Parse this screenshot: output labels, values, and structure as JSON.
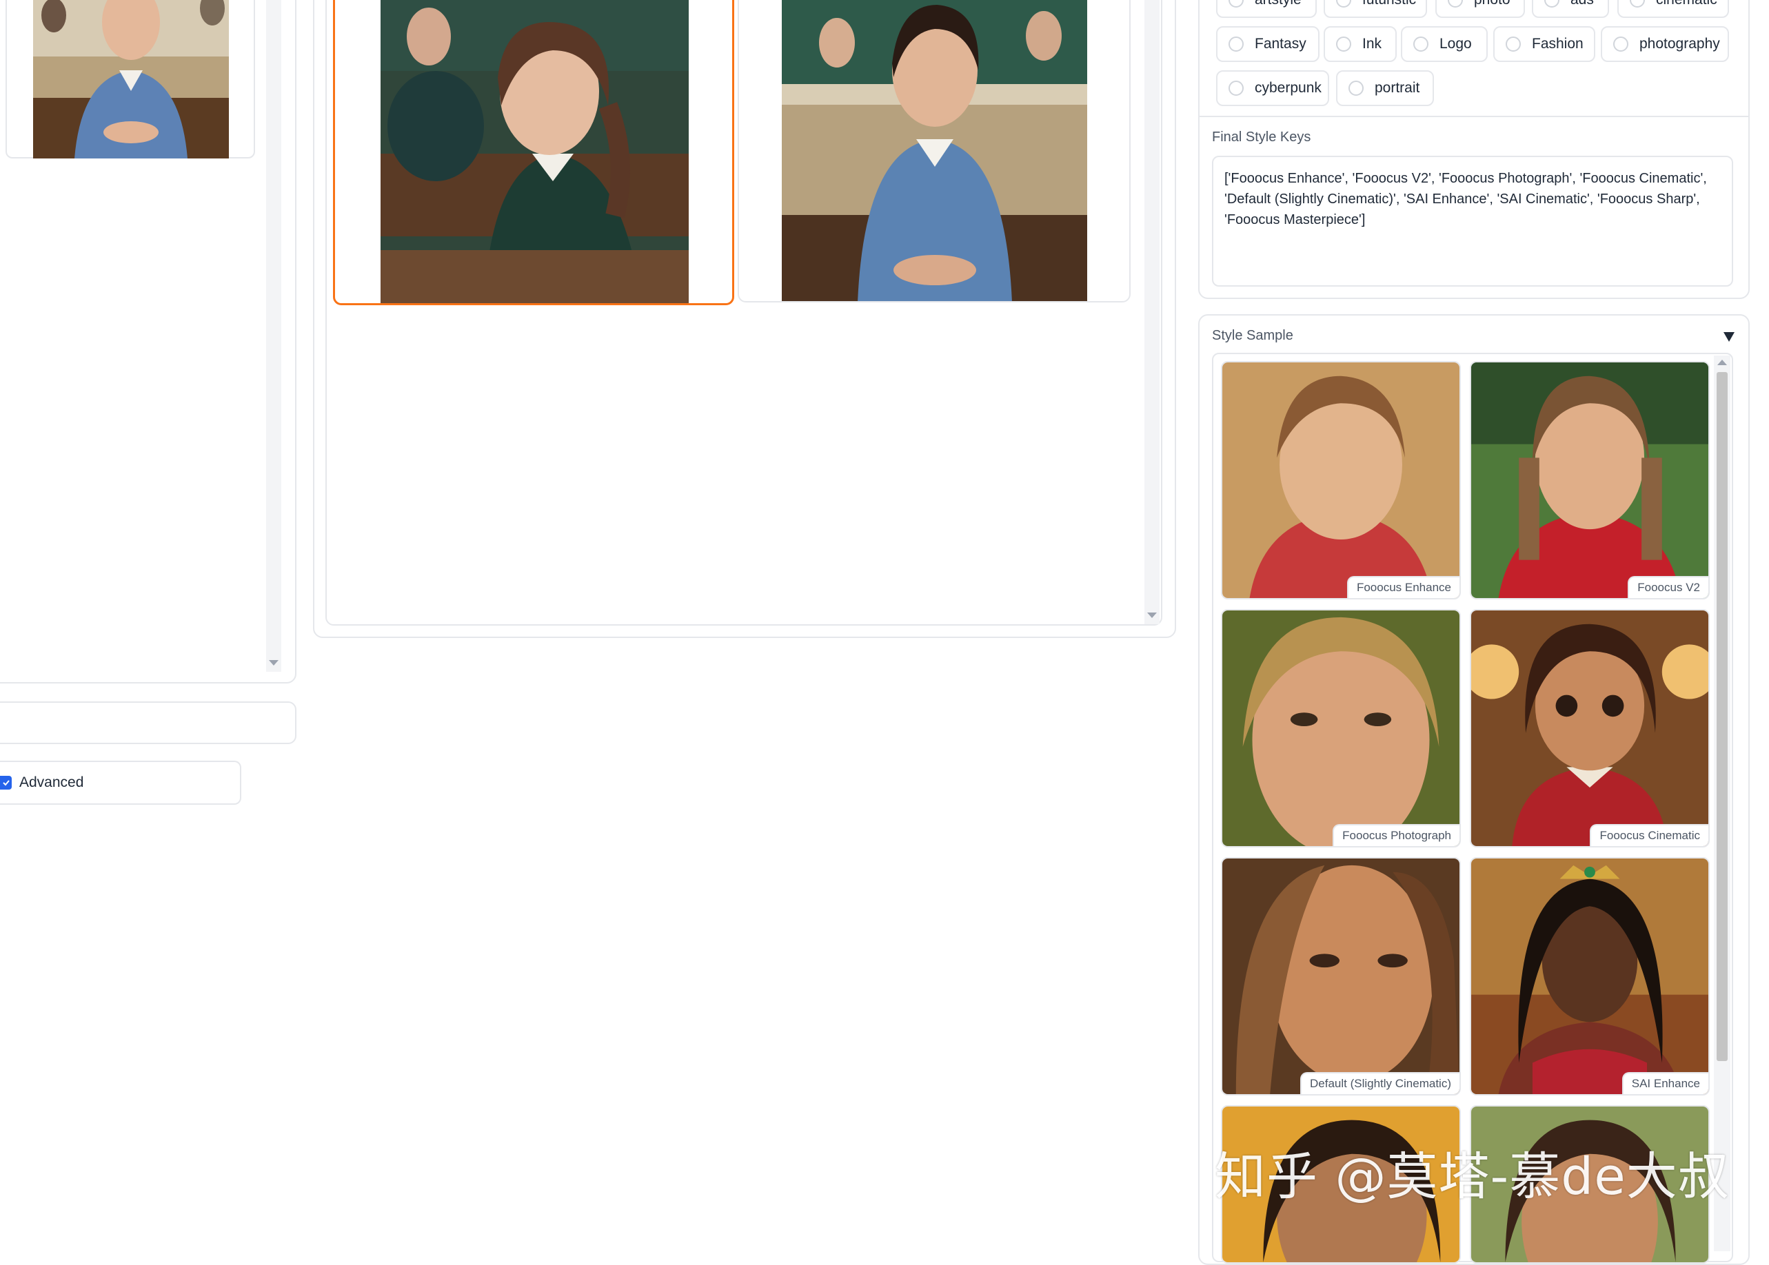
{
  "left_column": {
    "advanced_checkbox": {
      "label": "Advanced",
      "checked": true
    }
  },
  "style_filter_chips": [
    {
      "label": "artstyle"
    },
    {
      "label": "futuristic"
    },
    {
      "label": "photo"
    },
    {
      "label": "ads"
    },
    {
      "label": "cinematic"
    },
    {
      "label": "Fantasy"
    },
    {
      "label": "Ink"
    },
    {
      "label": "Logo"
    },
    {
      "label": "Fashion"
    },
    {
      "label": "photography"
    },
    {
      "label": "cyberpunk"
    },
    {
      "label": "portrait"
    }
  ],
  "final_style_keys": {
    "label": "Final Style Keys",
    "value": "['Fooocus Enhance', 'Fooocus V2', 'Fooocus Photograph', 'Fooocus Cinematic', 'Default (Slightly Cinematic)', 'SAI Enhance', 'SAI Cinematic', 'Fooocus Sharp', 'Fooocus Masterpiece']"
  },
  "style_sample": {
    "label": "Style Sample",
    "toggle_icon": "triangle-down-icon",
    "items": [
      {
        "caption": "Fooocus Enhance"
      },
      {
        "caption": "Fooocus V2"
      },
      {
        "caption": "Fooocus Photograph"
      },
      {
        "caption": "Fooocus Cinematic"
      },
      {
        "caption": "Default (Slightly Cinematic)"
      },
      {
        "caption": "SAI Enhance"
      }
    ]
  },
  "watermark": {
    "text": "知乎 @莫塔-慕de大叔"
  },
  "colors": {
    "selected_border": "#f97316",
    "checkbox_blue": "#2563eb",
    "panel_border": "#e5e7eb"
  }
}
